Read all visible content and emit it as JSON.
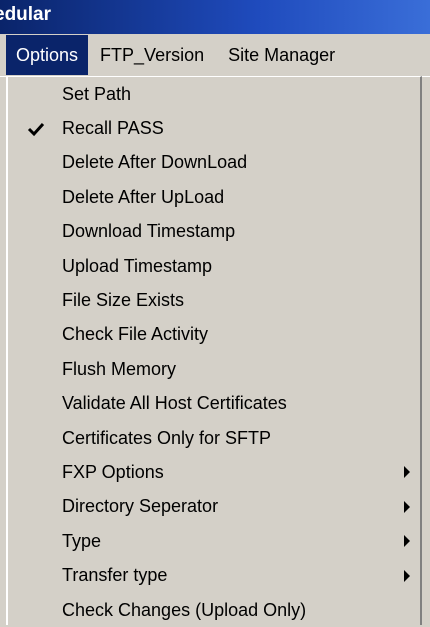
{
  "window": {
    "title_fragment": "edular"
  },
  "menubar": {
    "items": [
      {
        "label": "Options",
        "active": true
      },
      {
        "label": "FTP_Version",
        "active": false
      },
      {
        "label": "Site Manager",
        "active": false
      }
    ]
  },
  "menu": {
    "items": [
      {
        "label": "Set Path",
        "checked": false,
        "submenu": false
      },
      {
        "label": "Recall PASS",
        "checked": true,
        "submenu": false
      },
      {
        "label": "Delete After DownLoad",
        "checked": false,
        "submenu": false
      },
      {
        "label": "Delete After UpLoad",
        "checked": false,
        "submenu": false
      },
      {
        "label": "Download Timestamp",
        "checked": false,
        "submenu": false
      },
      {
        "label": "Upload Timestamp",
        "checked": false,
        "submenu": false
      },
      {
        "label": "File Size Exists",
        "checked": false,
        "submenu": false
      },
      {
        "label": "Check File Activity",
        "checked": false,
        "submenu": false
      },
      {
        "label": "Flush Memory",
        "checked": false,
        "submenu": false
      },
      {
        "label": "Validate All Host Certificates",
        "checked": false,
        "submenu": false
      },
      {
        "label": "Certificates Only for SFTP",
        "checked": false,
        "submenu": false
      },
      {
        "label": "FXP Options",
        "checked": false,
        "submenu": true
      },
      {
        "label": "Directory Seperator",
        "checked": false,
        "submenu": true
      },
      {
        "label": "Type",
        "checked": false,
        "submenu": true
      },
      {
        "label": "Transfer type",
        "checked": false,
        "submenu": true
      },
      {
        "label": "Check Changes (Upload Only)",
        "checked": false,
        "submenu": false
      }
    ]
  },
  "icons": {
    "check": "checkmark-icon",
    "submenu": "submenu-arrow-icon"
  },
  "colors": {
    "highlight": "#0a246a",
    "menu_bg": "#d4d0c8",
    "title_bg": "#0a246a"
  }
}
